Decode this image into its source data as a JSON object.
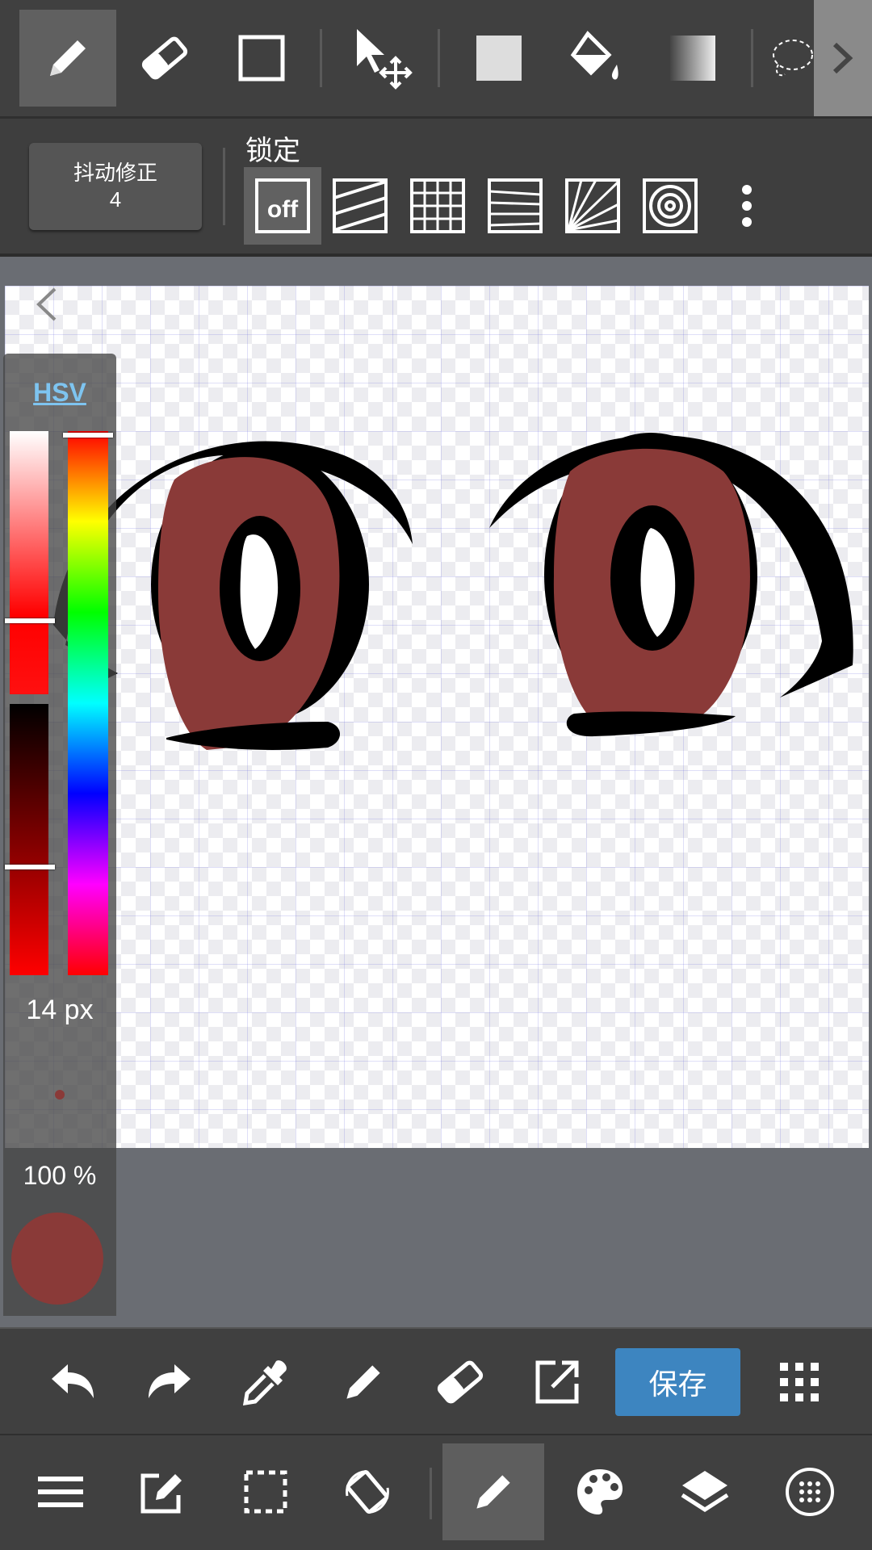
{
  "top_toolbar": {
    "tools": [
      {
        "icon": "pen-icon",
        "active": true
      },
      {
        "icon": "eraser-icon"
      },
      {
        "icon": "rectangle-icon"
      },
      {
        "icon": "move-icon"
      },
      {
        "icon": "fill-square-icon"
      },
      {
        "icon": "bucket-icon"
      },
      {
        "icon": "gradient-icon"
      },
      {
        "icon": "lasso-icon"
      }
    ],
    "expand_icon": "chevron-right-icon"
  },
  "lock_toolbar": {
    "stabilizer_label": "抖动修正",
    "stabilizer_value": "4",
    "lock_label": "锁定",
    "off_label": "off",
    "guides": [
      "guide-off-icon",
      "parallel-guide-icon",
      "grid-guide-icon",
      "perspective-guide-icon",
      "radial-guide-icon",
      "concentric-guide-icon"
    ],
    "more_icon": "more-vertical-icon"
  },
  "color_panel": {
    "mode_label": "HSV",
    "brush_size": "14 px",
    "opacity": "100 %",
    "current_color": "#8a3a38",
    "saturation": 0.72,
    "value": 0.6,
    "hue": 0.0
  },
  "action_bar": {
    "buttons": [
      "undo-icon",
      "redo-icon",
      "eyedropper-icon",
      "pen-icon",
      "eraser-icon",
      "export-icon"
    ],
    "save_label": "保存",
    "apps_icon": "grid-dots-icon"
  },
  "nav_bar": {
    "buttons": [
      "menu-icon",
      "edit-icon",
      "selection-icon",
      "rotate-icon",
      "brush-icon",
      "palette-icon",
      "layers-icon",
      "more-circle-icon"
    ],
    "active_index": 4
  },
  "colors": {
    "iris": "#8a3a38",
    "save_blue": "#3d85c0",
    "toolbar_bg": "#404040"
  }
}
